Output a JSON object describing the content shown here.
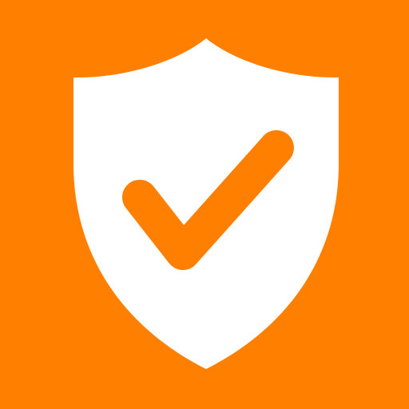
{
  "icon": {
    "name": "shield-check-icon",
    "colors": {
      "background": "#FF7F00",
      "shield": "#FFFFFF",
      "check": "#FF7F00"
    }
  }
}
